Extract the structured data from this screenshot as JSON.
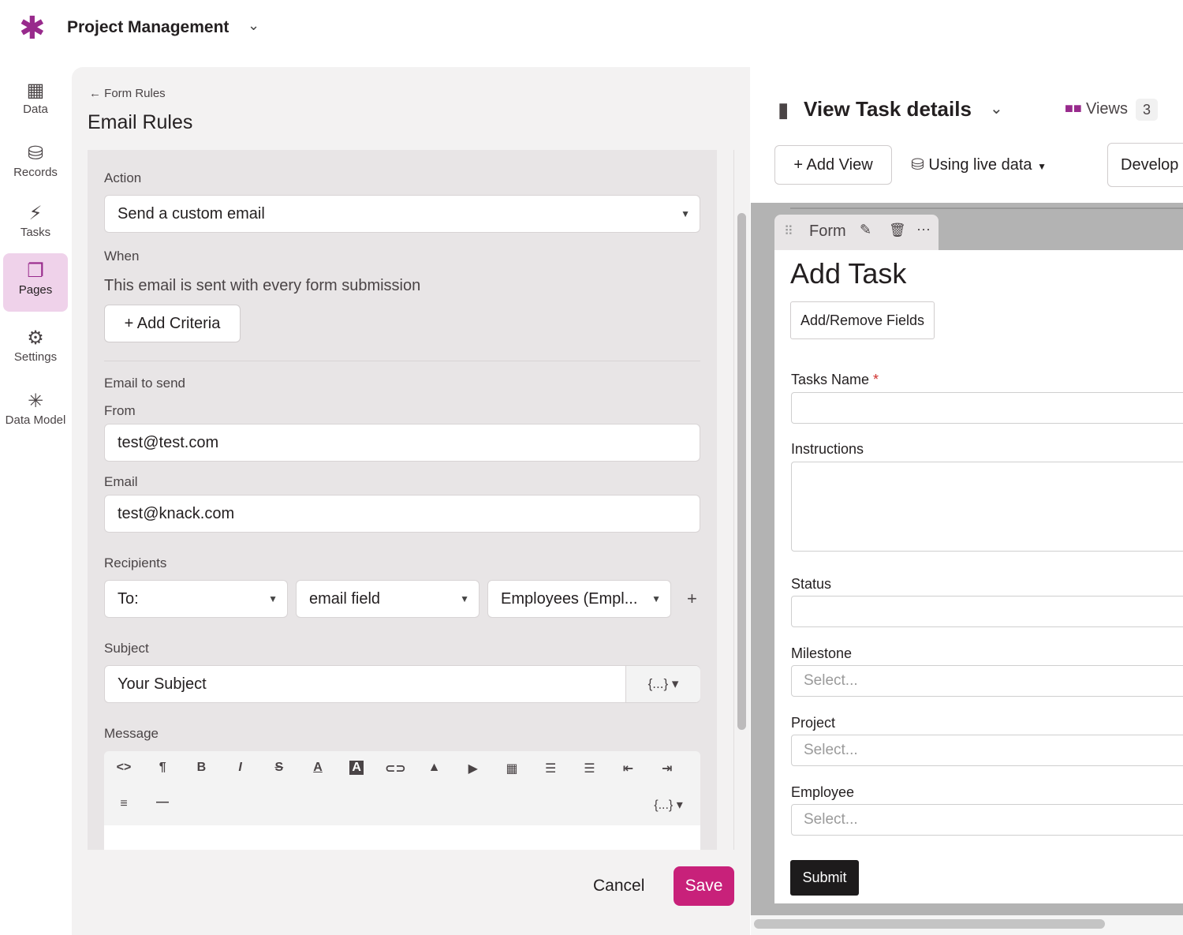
{
  "app": {
    "title": "Project Management",
    "logo_icon": "asterisk-logo",
    "accent": "#982a8c"
  },
  "sidebar": {
    "items": [
      {
        "label": "Data",
        "icon": "table-icon"
      },
      {
        "label": "Records",
        "icon": "database-icon"
      },
      {
        "label": "Tasks",
        "icon": "bolt-icon"
      },
      {
        "label": "Pages",
        "icon": "pages-icon",
        "active": true
      },
      {
        "label": "Settings",
        "icon": "gear-icon"
      },
      {
        "label": "Data Model",
        "icon": "network-icon"
      }
    ]
  },
  "left": {
    "breadcrumb": "Form Rules",
    "title": "Email Rules",
    "action_label": "Action",
    "action_value": "Send a custom email",
    "when_label": "When",
    "when_text": "This email is sent with every form submission",
    "add_criteria": "Add Criteria",
    "email_to_send": "Email to send",
    "from_label": "From",
    "from_value": "test@test.com",
    "email_label": "Email",
    "email_value": "test@knack.com",
    "recipients_label": "Recipients",
    "recipient_type": "To:",
    "recipient_field": "email field",
    "recipient_connection": "Employees (Empl...",
    "subject_label": "Subject",
    "subject_value": "Your Subject",
    "insert_field": "{...}",
    "message_label": "Message",
    "toolbar": [
      "<>",
      "¶",
      "B",
      "I",
      "S",
      "A",
      "A",
      "⊂⊃",
      "▲",
      "▶",
      "▦",
      "☰",
      "☰",
      "⇤",
      "⇥"
    ],
    "cancel": "Cancel",
    "save": "Save",
    "save_color": "#c8217a"
  },
  "right": {
    "page_title": "View Task details",
    "views_label": "Views",
    "views_count": "3",
    "add_view": "Add View",
    "live_data": "Using live data",
    "develop": "Develop",
    "view_tab": "Form",
    "form_title": "Add Task",
    "add_remove_fields": "Add/Remove Fields",
    "fields": [
      {
        "label": "Tasks Name",
        "required": "*"
      },
      {
        "label": "Instructions"
      },
      {
        "label": "Status"
      },
      {
        "label": "Milestone",
        "placeholder": "Select..."
      },
      {
        "label": "Project",
        "placeholder": "Select..."
      },
      {
        "label": "Employee",
        "placeholder": "Select..."
      }
    ],
    "submit": "Submit"
  }
}
